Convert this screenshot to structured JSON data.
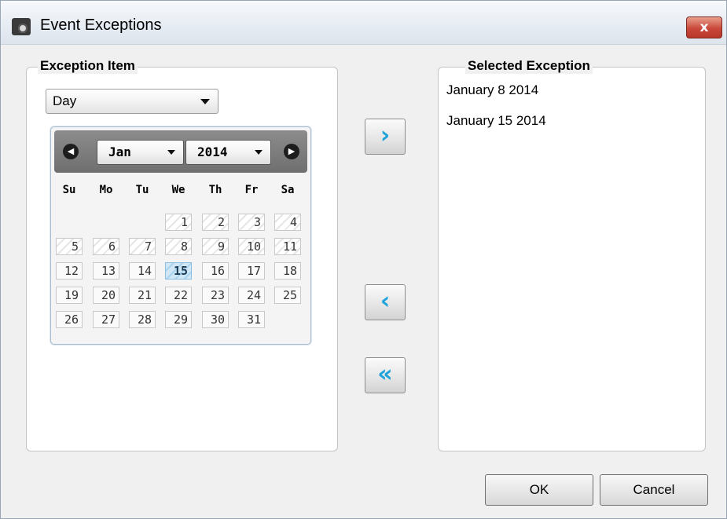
{
  "window": {
    "title": "Event Exceptions",
    "close_label": "x"
  },
  "exception_item": {
    "group_title": "Exception Item",
    "type_select": {
      "value": "Day"
    },
    "calendar": {
      "prev_label": "◀",
      "next_label": "▶",
      "month": "Jan",
      "year": "2014",
      "weekdays": [
        "Su",
        "Mo",
        "Tu",
        "We",
        "Th",
        "Fr",
        "Sa"
      ],
      "days": [
        "1",
        "2",
        "3",
        "4",
        "5",
        "6",
        "7",
        "8",
        "9",
        "10",
        "11",
        "12",
        "13",
        "14",
        "15",
        "16",
        "17",
        "18",
        "19",
        "20",
        "21",
        "22",
        "23",
        "24",
        "25",
        "26",
        "27",
        "28",
        "29",
        "30",
        "31"
      ],
      "selected_day": "15"
    }
  },
  "transfer_buttons": {
    "add": "›",
    "remove": "‹",
    "remove_all": "«"
  },
  "selected_exception": {
    "group_title": "Selected Exception",
    "items": [
      "January 8 2014",
      "January 15 2014"
    ]
  },
  "buttons": {
    "ok": "OK",
    "cancel": "Cancel"
  },
  "colors": {
    "accent": "#1fa3d9",
    "selected_day": "#a9d3ef"
  }
}
